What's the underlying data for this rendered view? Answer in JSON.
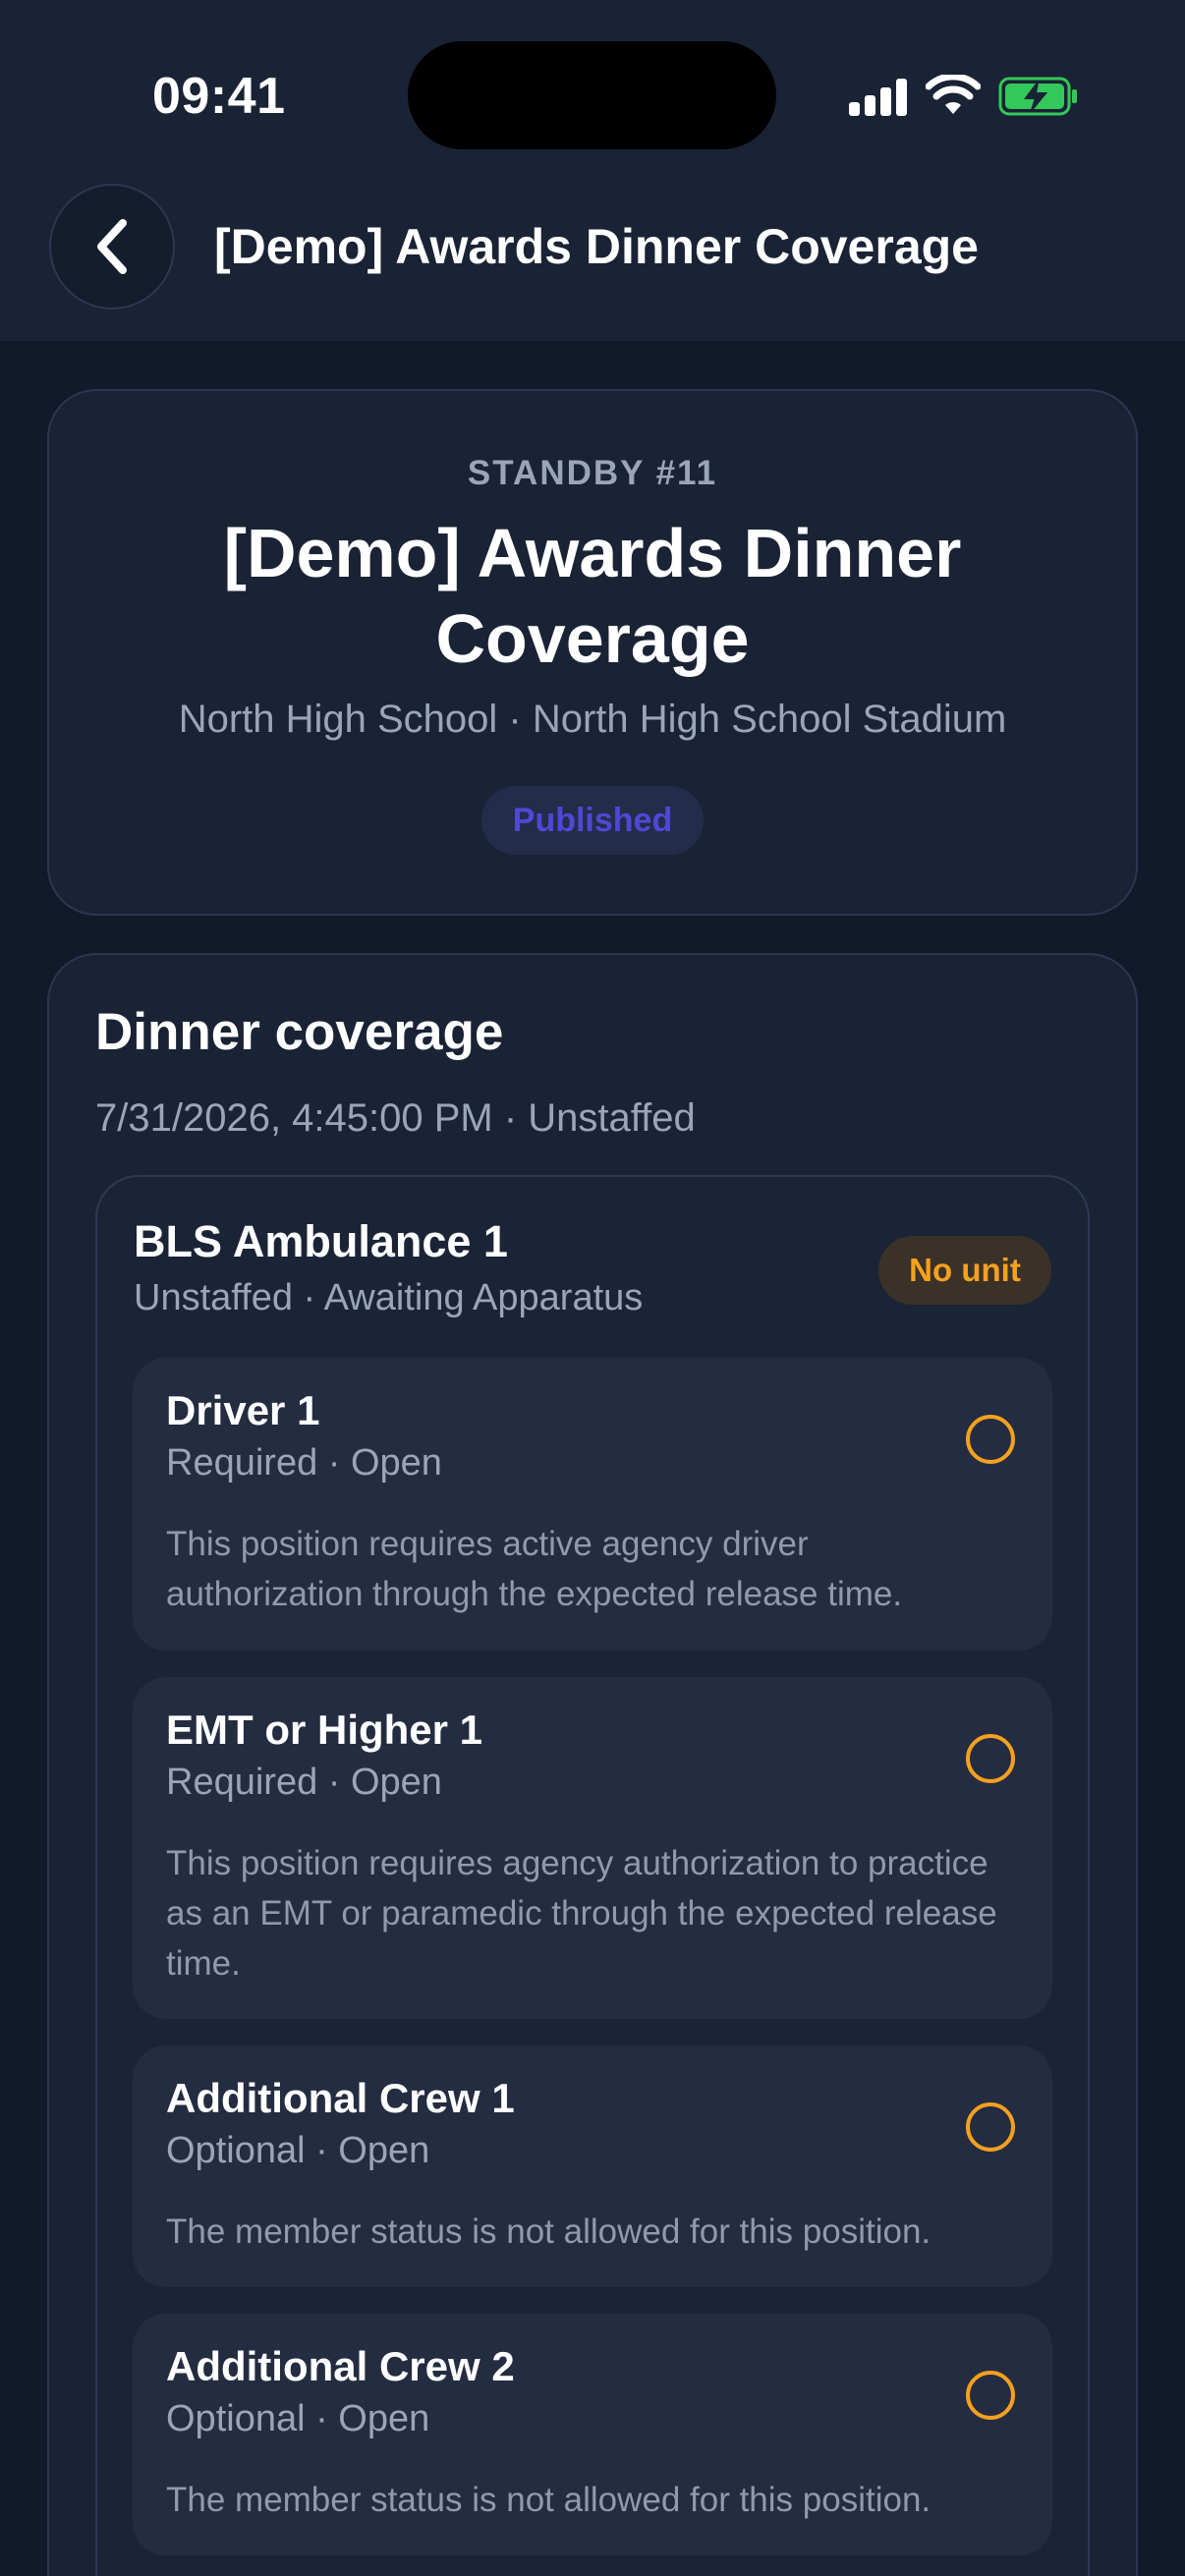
{
  "status_bar": {
    "time": "09:41"
  },
  "header": {
    "title": "[Demo] Awards Dinner Coverage"
  },
  "summary": {
    "standby_label": "STANDBY #11",
    "title": "[Demo] Awards Dinner Coverage",
    "location": "North High School · North High School Stadium",
    "status": "Published"
  },
  "shift": {
    "title": "Dinner coverage",
    "meta": "7/31/2026, 4:45:00 PM · Unstaffed",
    "unit": {
      "name": "BLS Ambulance 1",
      "status": "Unstaffed · Awaiting Apparatus",
      "badge": "No unit"
    },
    "positions": [
      {
        "title": "Driver 1",
        "meta": "Required · Open",
        "desc": "This position requires active agency driver authorization through the expected release time."
      },
      {
        "title": "EMT or Higher 1",
        "meta": "Required · Open",
        "desc": "This position requires agency authorization to practice as an EMT or paramedic through the expected release time."
      },
      {
        "title": "Additional Crew 1",
        "meta": "Optional · Open",
        "desc": "The member status is not allowed for this position."
      },
      {
        "title": "Additional Crew 2",
        "meta": "Optional · Open",
        "desc": "The member status is not allowed for this position."
      }
    ]
  },
  "colors": {
    "background": "#111a2b",
    "card": "#1a2335",
    "accent_warning": "#f5a01e",
    "published": "#4f48d6"
  },
  "icons": [
    "chevron-left-icon",
    "signal-icon",
    "wifi-icon",
    "battery-charging-icon",
    "radio-empty-icon"
  ]
}
